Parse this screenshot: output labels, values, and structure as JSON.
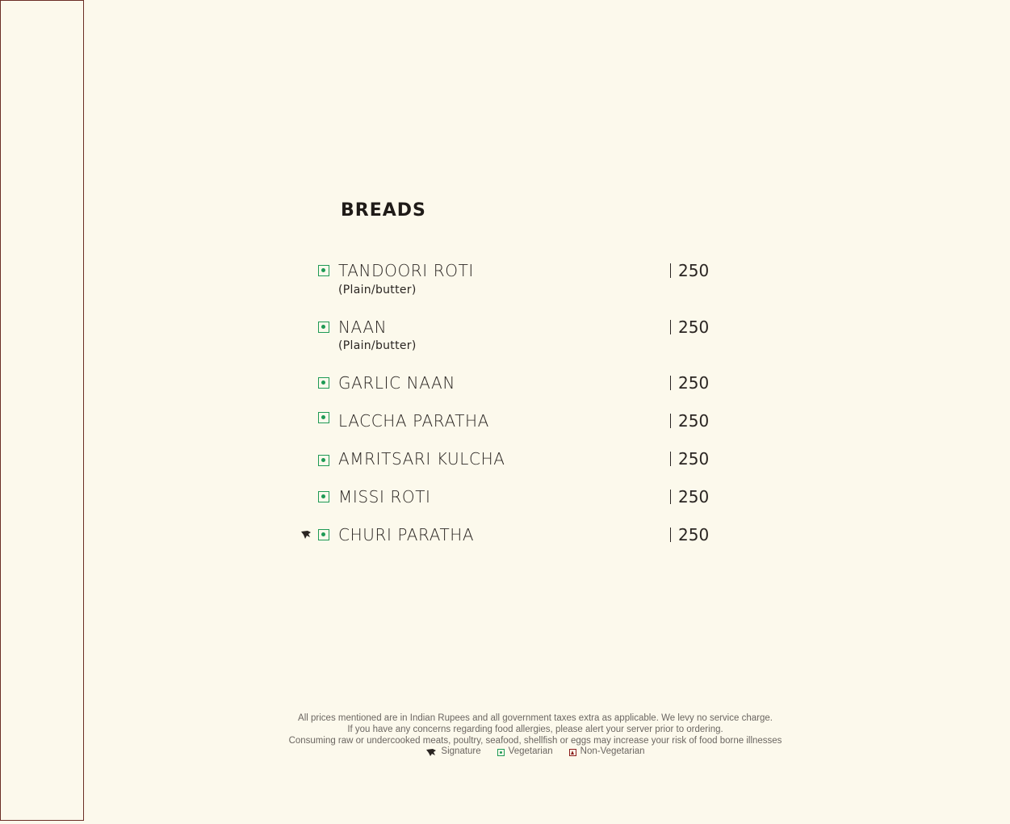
{
  "section": {
    "title": "BREADS"
  },
  "items": [
    {
      "name": "TANDOORI ROTI",
      "desc": "(Plain/butter)",
      "price": "250",
      "veg": true,
      "signature": false
    },
    {
      "name": "NAAN",
      "desc": "(Plain/butter)",
      "price": "250",
      "veg": true,
      "signature": false
    },
    {
      "name": "GARLIC NAAN",
      "desc": "",
      "price": "250",
      "veg": true,
      "signature": false
    },
    {
      "name": "LACCHA PARATHA",
      "desc": "",
      "price": "250",
      "veg": true,
      "signature": false
    },
    {
      "name": "AMRITSARI KULCHA",
      "desc": "",
      "price": "250",
      "veg": true,
      "signature": false
    },
    {
      "name": "MISSI ROTI",
      "desc": "",
      "price": "250",
      "veg": true,
      "signature": false
    },
    {
      "name": "CHURI PARATHA",
      "desc": "",
      "price": "250",
      "veg": true,
      "signature": true
    }
  ],
  "footer": {
    "line1": "All prices mentioned are in Indian Rupees and all government taxes extra as applicable. We levy no service charge.",
    "line2": "If you have any concerns regarding food allergies, please alert your server prior to ordering.",
    "line3": "Consuming raw or undercooked meats, poultry, seafood, shellfish or eggs may increase your risk of food borne illnesses"
  },
  "legend": {
    "signature": "Signature",
    "vegetarian": "Vegetarian",
    "non_vegetarian": "Non-Vegetarian"
  },
  "colors": {
    "background": "#fcf9ec",
    "veg_green": "#1e9a55",
    "nonveg_red": "#8b1d1d",
    "border_brown": "#6b2e25"
  },
  "icons": {
    "veg": "veg-square-dot-icon",
    "nonveg": "nonveg-square-triangle-icon",
    "signature": "chef-hat-icon"
  }
}
